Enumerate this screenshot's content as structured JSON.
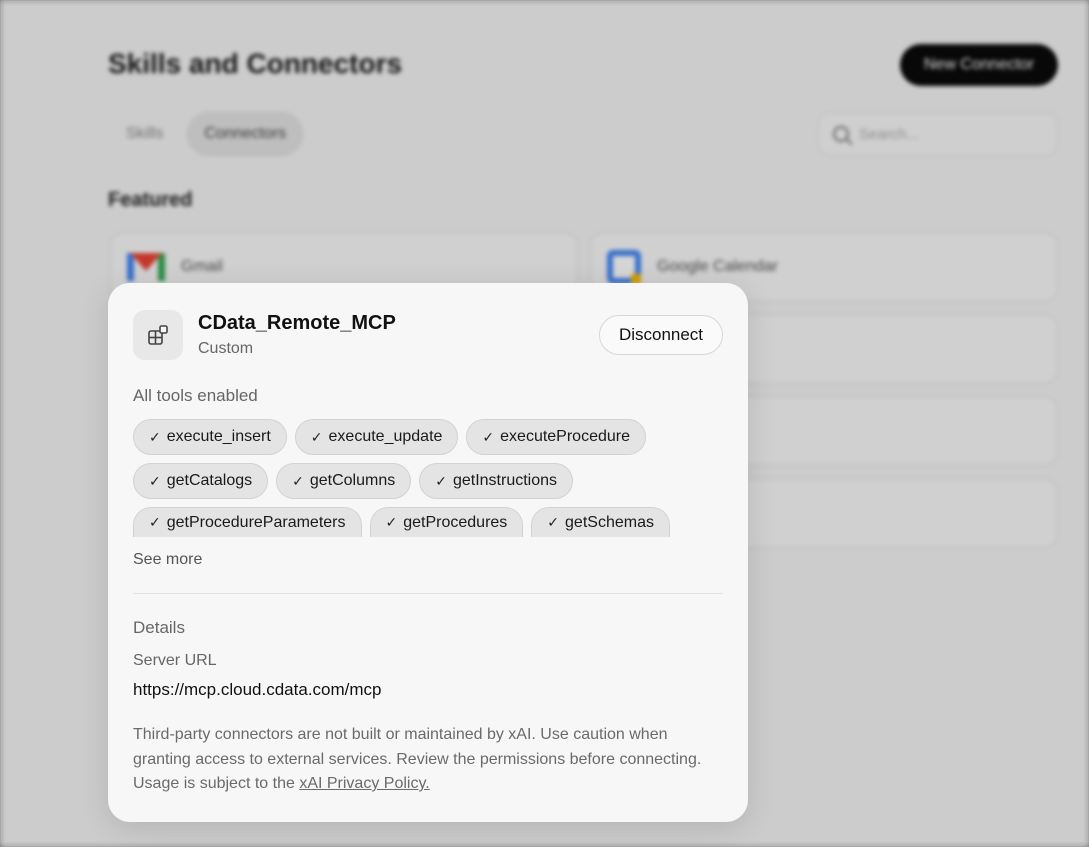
{
  "background": {
    "title": "Skills and Connectors",
    "new_connector_label": "New Connector",
    "tabs": [
      {
        "label": "Skills",
        "active": false
      },
      {
        "label": "Connectors",
        "active": true
      }
    ],
    "search_placeholder": "Search...",
    "featured_label": "Featured",
    "featured": [
      {
        "name": "Gmail",
        "icon": "gmail-icon"
      },
      {
        "name": "Google Calendar",
        "icon": "google-calendar-icon"
      }
    ]
  },
  "modal": {
    "icon": "connector-blocks-icon",
    "name": "CData_Remote_MCP",
    "kind": "Custom",
    "disconnect_label": "Disconnect",
    "tools_label": "All tools enabled",
    "check_glyph": "✓",
    "tools": [
      [
        "execute_insert",
        "execute_update",
        "executeProcedure"
      ],
      [
        "getCatalogs",
        "getColumns",
        "getInstructions"
      ],
      [
        "getProcedureParameters",
        "getProcedures",
        "getSchemas"
      ]
    ],
    "see_more_label": "See more",
    "details_label": "Details",
    "server_url_label": "Server URL",
    "server_url": "https://mcp.cloud.cdata.com/mcp",
    "disclaimer_text": "Third-party connectors are not built or maintained by xAI. Use caution when granting access to external services. Review the permissions before connecting. Usage is subject to the ",
    "privacy_link_label": "xAI Privacy Policy."
  }
}
